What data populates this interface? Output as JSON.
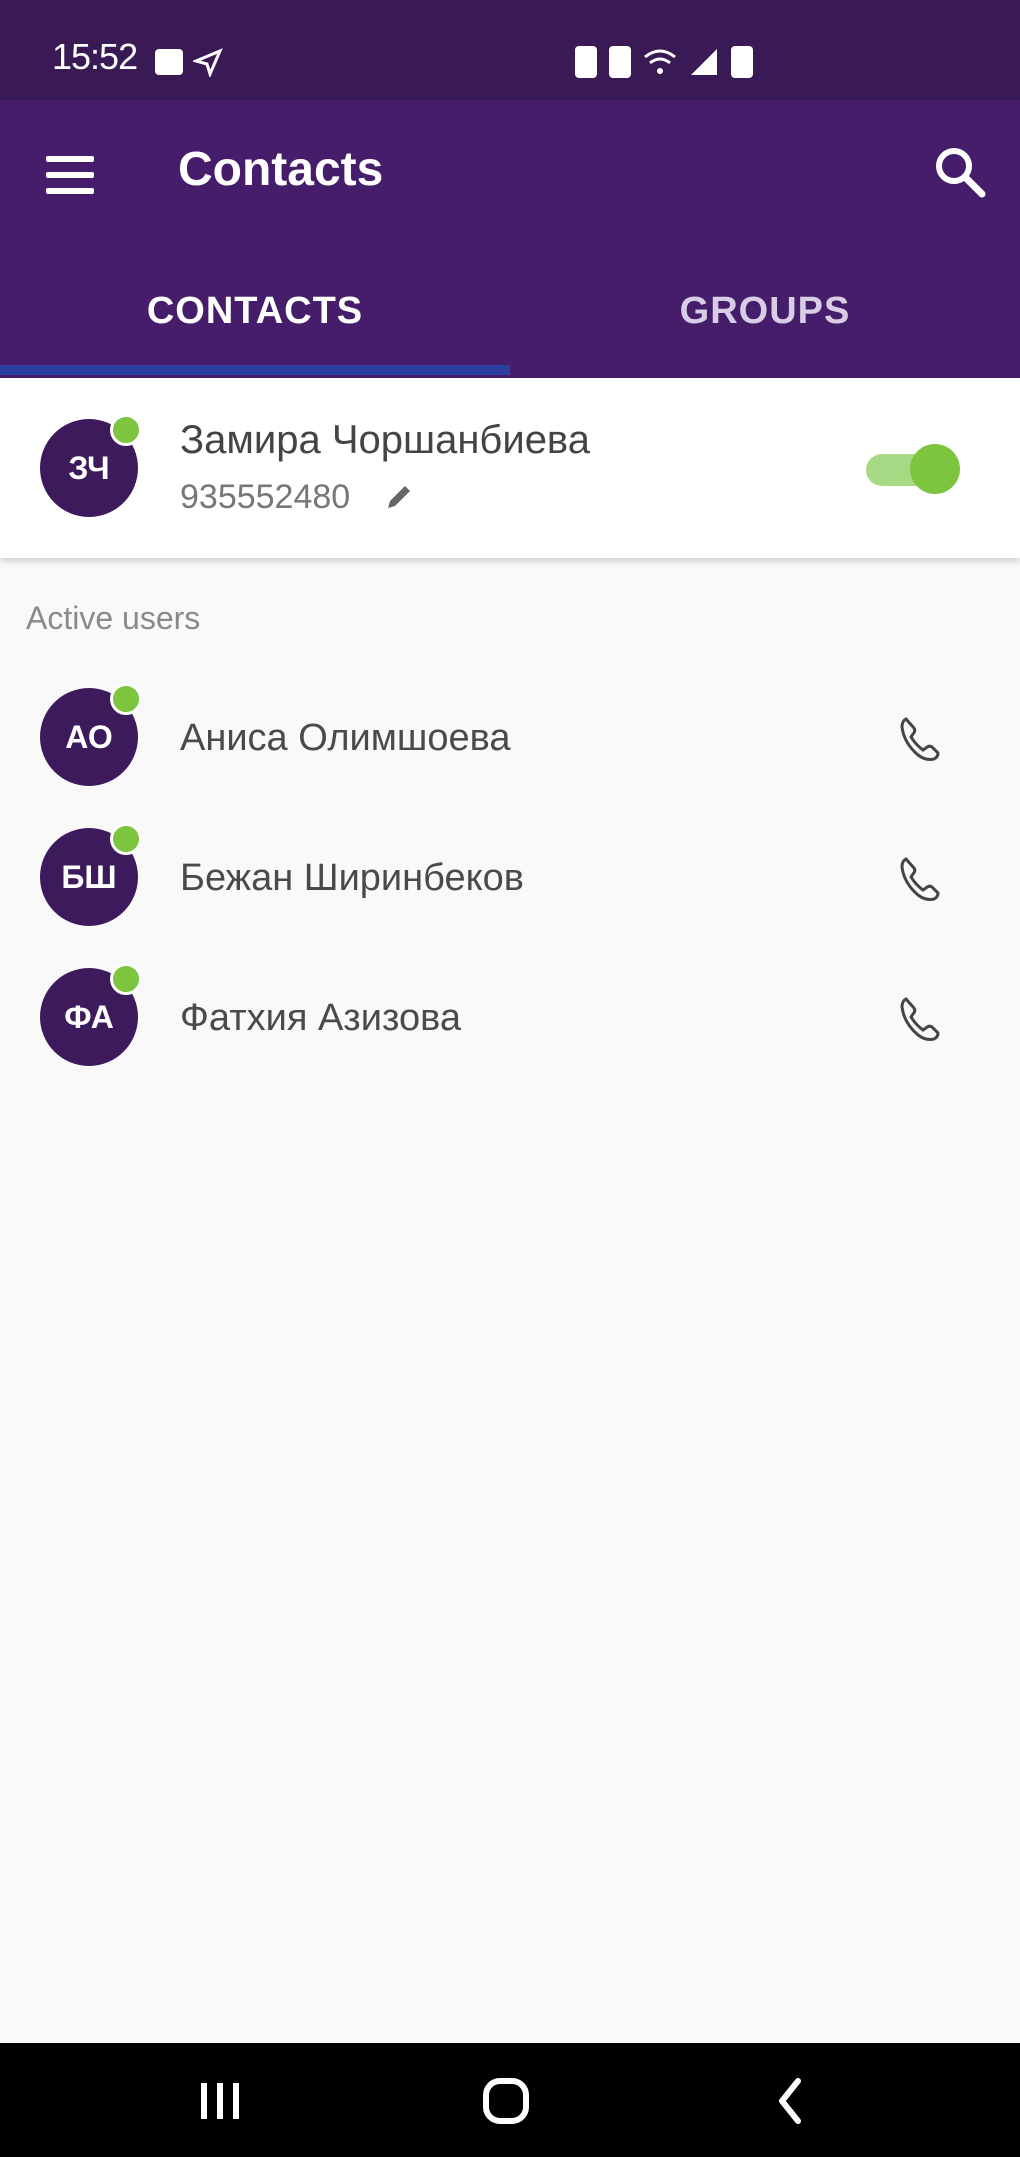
{
  "status_bar": {
    "time": "15:52",
    "icons": [
      "notification-icon",
      "navigation-icon",
      "alarm-icon",
      "vibrate-icon",
      "wifi-icon",
      "signal-icon",
      "battery-icon"
    ]
  },
  "app_bar": {
    "title": "Contacts",
    "menu_icon": "menu-icon",
    "search_icon": "search-icon"
  },
  "tabs": [
    {
      "label": "CONTACTS",
      "selected": true
    },
    {
      "label": "GROUPS",
      "selected": false
    }
  ],
  "self_contact": {
    "initials": "ЗЧ",
    "name": "Замира Чоршанбиева",
    "phone": "935552480",
    "online": true,
    "toggle_on": true
  },
  "active_users": {
    "label": "Active users",
    "items": [
      {
        "initials": "АО",
        "name": "Аниса  Олимшоева",
        "online": true
      },
      {
        "initials": "БШ",
        "name": "Бежан Ширинбеков",
        "online": true
      },
      {
        "initials": "ФА",
        "name": "Фатхия Азизова",
        "online": true
      }
    ]
  },
  "colors": {
    "status_bar": "#3a1a55",
    "app_bar": "#451d6b",
    "tab_indicator": "#2b3fa0",
    "avatar_bg": "#3d1a5c",
    "online": "#7dc43f"
  },
  "nav_bar": {
    "buttons": [
      "recents-icon",
      "home-icon",
      "back-icon"
    ]
  }
}
